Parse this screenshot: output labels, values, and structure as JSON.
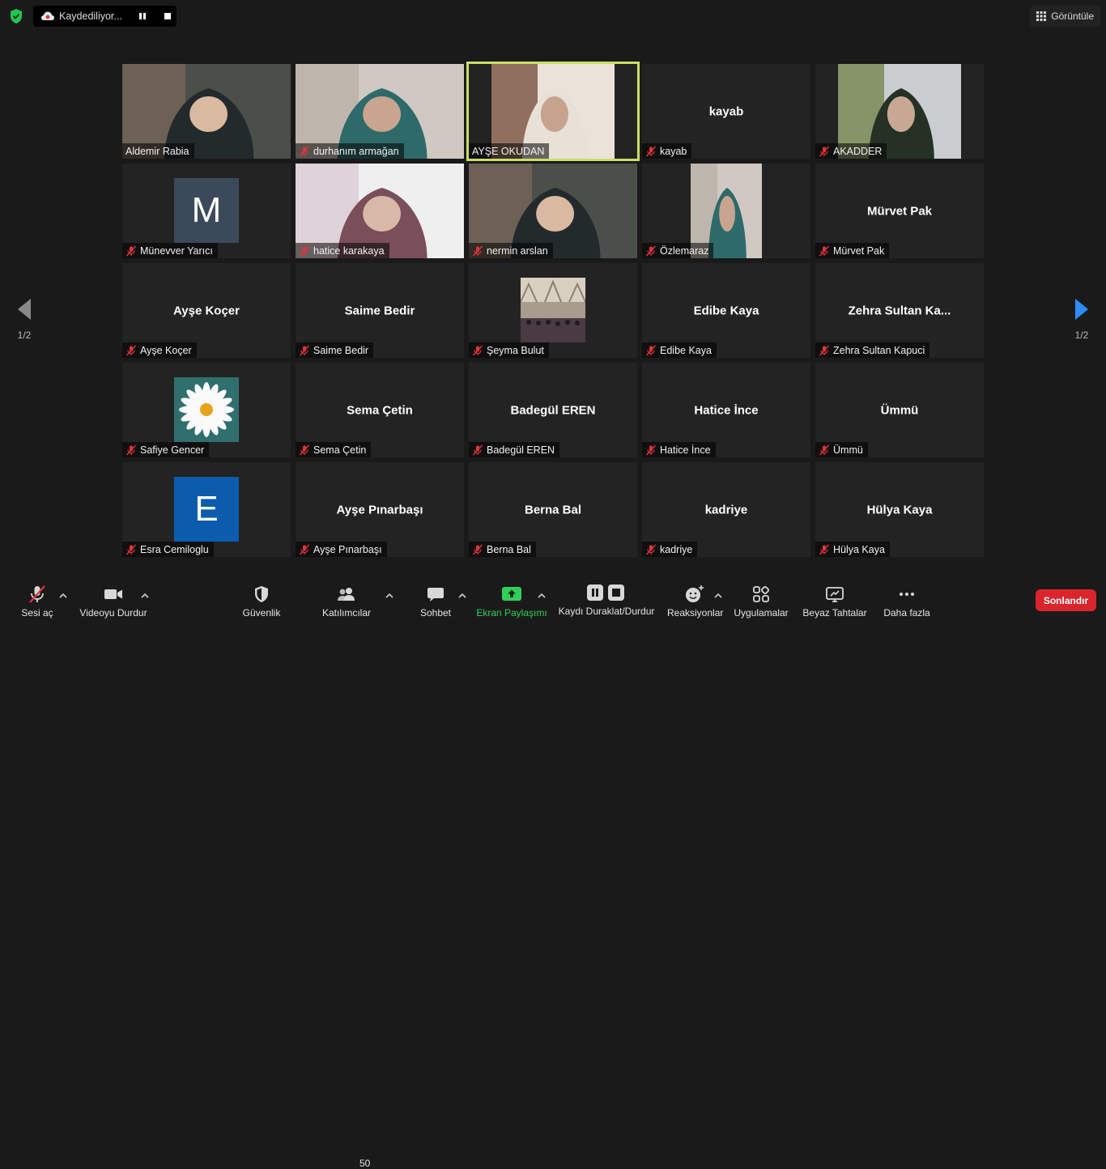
{
  "top": {
    "recording_label": "Kaydediliyor...",
    "view_label": "Görüntüle"
  },
  "pagination": {
    "left_page": "1/2",
    "right_page": "1/2"
  },
  "participants": [
    {
      "name": "Aldemir Rabia",
      "display": "",
      "muted": false,
      "type": "video"
    },
    {
      "name": "durhanım armağan",
      "display": "",
      "muted": true,
      "type": "video"
    },
    {
      "name": "AYŞE OKUDAN",
      "display": "",
      "muted": false,
      "type": "video",
      "active": true
    },
    {
      "name": "kayab",
      "display": "kayab",
      "muted": true,
      "type": "text"
    },
    {
      "name": "AKADDER",
      "display": "",
      "muted": true,
      "type": "video"
    },
    {
      "name": "Münevver Yarıcı",
      "display": "",
      "muted": true,
      "type": "avatar",
      "letter": "M",
      "avatar_color": "#3b4a5a"
    },
    {
      "name": "hatice karakaya",
      "display": "",
      "muted": true,
      "type": "video"
    },
    {
      "name": "nermin arslan",
      "display": "",
      "muted": true,
      "type": "video"
    },
    {
      "name": "Özlemaraz",
      "display": "",
      "muted": true,
      "type": "video"
    },
    {
      "name": "Mürvet Pak",
      "display": "Mürvet Pak",
      "muted": true,
      "type": "text"
    },
    {
      "name": "Ayşe Koçer",
      "display": "Ayşe Koçer",
      "muted": true,
      "type": "text"
    },
    {
      "name": "Saime Bedir",
      "display": "Saime Bedir",
      "muted": true,
      "type": "text"
    },
    {
      "name": "Şeyma Bulut",
      "display": "",
      "muted": true,
      "type": "photo"
    },
    {
      "name": "Edibe Kaya",
      "display": "Edibe Kaya",
      "muted": true,
      "type": "text"
    },
    {
      "name": "Zehra Sultan Kapuci",
      "display": "Zehra Sultan Ka...",
      "muted": true,
      "type": "text"
    },
    {
      "name": "Safiye Gencer",
      "display": "",
      "muted": true,
      "type": "flower"
    },
    {
      "name": "Sema Çetin",
      "display": "Sema Çetin",
      "muted": true,
      "type": "text"
    },
    {
      "name": "Badegül EREN",
      "display": "Badegül EREN",
      "muted": true,
      "type": "text"
    },
    {
      "name": "Hatice İnce",
      "display": "Hatice İnce",
      "muted": true,
      "type": "text"
    },
    {
      "name": "Ümmü",
      "display": "Ümmü",
      "muted": true,
      "type": "text"
    },
    {
      "name": "Esra Cemiloglu",
      "display": "",
      "muted": true,
      "type": "avatar",
      "letter": "E",
      "avatar_color": "#0b5cad"
    },
    {
      "name": "Ayşe Pınarbaşı",
      "display": "Ayşe Pınarbaşı",
      "muted": true,
      "type": "text"
    },
    {
      "name": "Berna Bal",
      "display": "Berna Bal",
      "muted": true,
      "type": "text"
    },
    {
      "name": "kadriye",
      "display": "kadriye",
      "muted": true,
      "type": "text"
    },
    {
      "name": "Hülya Kaya",
      "display": "Hülya Kaya",
      "muted": true,
      "type": "text"
    }
  ],
  "toolbar": {
    "unmute": "Sesi aç",
    "stop_video": "Videoyu Durdur",
    "security": "Güvenlik",
    "participants": "Katılımcılar",
    "participant_count": "50",
    "chat": "Sohbet",
    "share_screen": "Ekran Paylaşımı",
    "pause_stop_recording": "Kaydı Duraklat/Durdur",
    "reactions": "Reaksiyonlar",
    "apps": "Uygulamalar",
    "whiteboards": "Beyaz Tahtalar",
    "more": "Daha fazla",
    "end": "Sonlandır"
  },
  "colors": {
    "accent_green": "#2fd05a",
    "active_speaker": "#c8df64",
    "end_button": "#d9252b",
    "mute_red": "#e0343a"
  }
}
